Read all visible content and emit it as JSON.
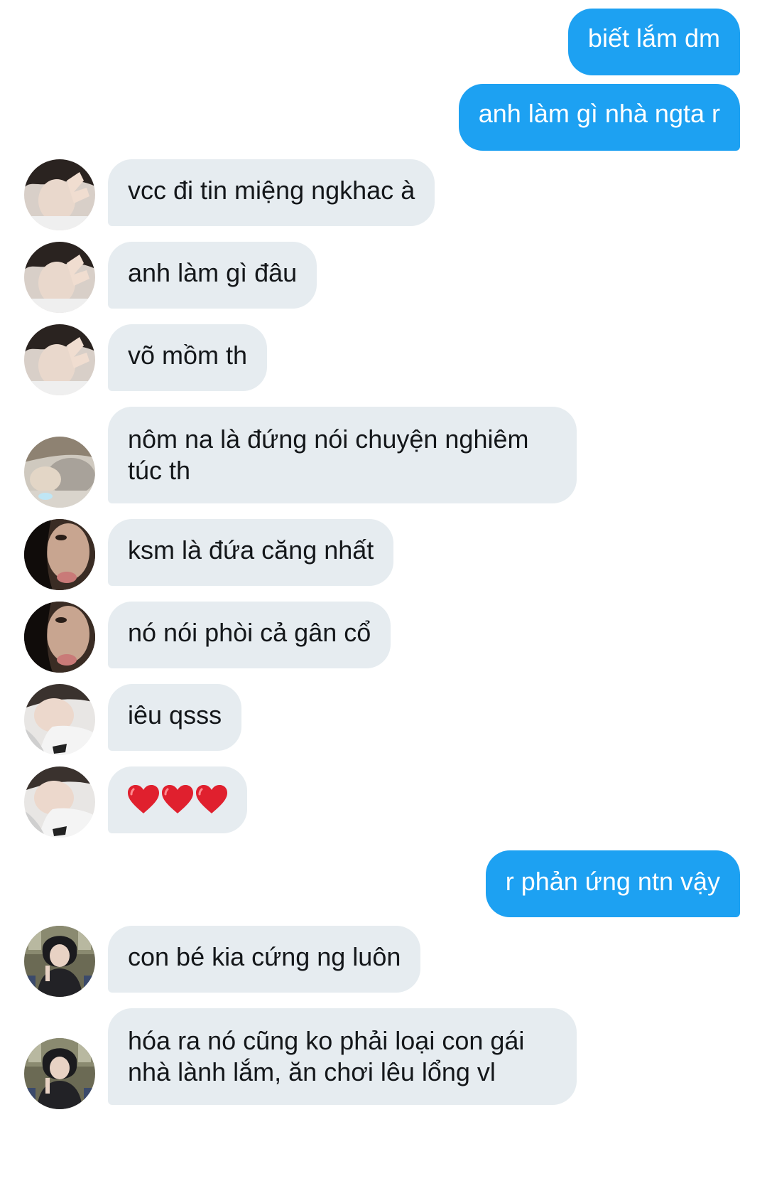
{
  "messages": [
    {
      "id": "m1",
      "direction": "out",
      "text": "biết lắm dm"
    },
    {
      "id": "m2",
      "direction": "out",
      "text": "anh làm gì nhà ngta r"
    },
    {
      "id": "m3",
      "direction": "in",
      "text": "vcc đi tin miệng ngkhac à",
      "avatar": "user-a-avatar"
    },
    {
      "id": "m4",
      "direction": "in",
      "text": "anh làm gì đâu",
      "avatar": "user-a-avatar"
    },
    {
      "id": "m5",
      "direction": "in",
      "text": "võ mồm th",
      "avatar": "user-a-avatar"
    },
    {
      "id": "m6",
      "direction": "in",
      "text": "nôm na là đứng nói chuyện nghiêm túc th",
      "avatar": "user-b-avatar"
    },
    {
      "id": "m7",
      "direction": "in",
      "text": "ksm là đứa căng nhất",
      "avatar": "user-c-avatar"
    },
    {
      "id": "m8",
      "direction": "in",
      "text": "nó nói phòi cả gân cổ",
      "avatar": "user-c-avatar"
    },
    {
      "id": "m9",
      "direction": "in",
      "text": "iêu qsss",
      "avatar": "user-d-avatar"
    },
    {
      "id": "m10",
      "direction": "in",
      "emoji": [
        "heart",
        "heart",
        "heart"
      ],
      "avatar": "user-d-avatar"
    },
    {
      "id": "m11",
      "direction": "out",
      "text": "r phản ứng ntn vậy"
    },
    {
      "id": "m12",
      "direction": "in",
      "text": "con bé kia cứng ng luôn",
      "avatar": "user-e-avatar"
    },
    {
      "id": "m13",
      "direction": "in",
      "text": "hóa ra nó cũng ko phải loại con gái nhà lành lắm, ăn chơi lêu lổng vl",
      "avatar": "user-e-avatar"
    }
  ],
  "colors": {
    "outgoing_bubble": "#1da1f2",
    "outgoing_text": "#ffffff",
    "incoming_bubble": "#e6ecf0",
    "incoming_text": "#14171a",
    "heart": "#e0202e"
  }
}
